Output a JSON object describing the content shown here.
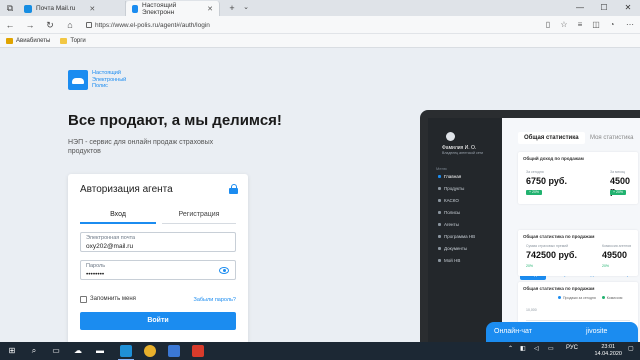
{
  "browser": {
    "tabs": [
      {
        "label": "Почта Mail.ru",
        "active": false
      },
      {
        "label": "Настоящий Электронн",
        "active": true
      }
    ],
    "new_tab": "+",
    "url": "https://www.el-polis.ru/agent#/auth/login",
    "bookmarks": [
      {
        "label": "Авиабилеты",
        "color": "#e0a400"
      },
      {
        "label": "Торги",
        "color": "#f2c744"
      }
    ],
    "controls": {
      "minimize": "—",
      "maximize": "☐",
      "close": "✕"
    }
  },
  "page": {
    "logo_text": "Настоящий Электронный Полис",
    "headline": "Все продают, а мы делимся!",
    "subline": "НЭП - сервис для онлайн продаж страховых продуктов",
    "auth": {
      "title": "Авторизация агента",
      "tab_login": "Вход",
      "tab_register": "Регистрация",
      "email_label": "Электронная почта",
      "email_value": "oxy202@mail.ru",
      "password_label": "Пароль",
      "password_value": "••••••••",
      "remember": "Запомнить меня",
      "forgot": "Забыли пароль?",
      "submit": "Войти"
    }
  },
  "dashboard": {
    "user_name": "Фамилия И. О.",
    "user_role": "Владелец агентской сети",
    "menu_header": "Меню",
    "menu": [
      {
        "label": "Главная",
        "active": true
      },
      {
        "label": "Продукты",
        "active": false
      },
      {
        "label": "КАСКО",
        "active": false
      },
      {
        "label": "Полисы",
        "active": false
      },
      {
        "label": "Агенты",
        "active": false
      },
      {
        "label": "Программа НВ",
        "active": false
      },
      {
        "label": "Документы",
        "active": false
      },
      {
        "label": "Мой НВ",
        "active": false
      }
    ],
    "tab_general": "Общая статистика",
    "tab_mine": "Моя статистика",
    "income_title": "Общий доход по продажам",
    "income_left_label": "За сегодня",
    "income_left_value": "6750 руб.",
    "income_left_badge": "+ 20%",
    "income_right_label": "За месяц",
    "income_right_value": "4500 р",
    "income_right_badge": "+ 20%",
    "period_tabs": [
      "Сегодня",
      "Вчера",
      "Неделя",
      "Месяц"
    ],
    "sales_title": "Общая статистика по продажам",
    "sales_left_label": "Сумма страховых премий",
    "sales_left_value": "742500 руб.",
    "sales_left_badge": "20%",
    "sales_right_label": "Комиссия агентов",
    "sales_right_value": "49500",
    "sales_right_badge": "20%",
    "chart_title": "Общая статистика по продажам",
    "chart_legend": [
      "Продажи за сегодня",
      "Комиссия"
    ],
    "chart_axis_top": "10,000"
  },
  "chat": {
    "title": "Онлайн-чат",
    "brand": "jivosite"
  },
  "taskbar": {
    "lang": "РУС",
    "time": "23:01",
    "date": "14.04.2020"
  }
}
